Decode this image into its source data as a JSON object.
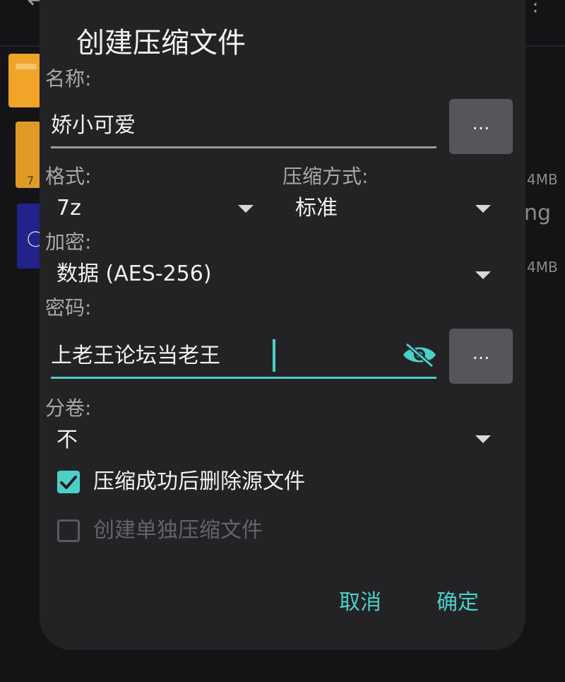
{
  "dialog": {
    "title": "创建压缩文件",
    "name_label": "名称:",
    "name_value": "娇小可爱",
    "name_browse_label": "...",
    "format_label": "格式:",
    "format_value": "7z",
    "compression_label": "压缩方式:",
    "compression_value": "标准",
    "encryption_label": "加密:",
    "encryption_value": "数据 (AES-256)",
    "password_label": "密码:",
    "password_value": "上老王论坛当老王",
    "password_browse_label": "...",
    "split_label": "分卷:",
    "split_value": "不",
    "delete_source": {
      "label": "压缩成功后删除源文件",
      "checked": true
    },
    "separate_archives": {
      "label": "创建单独压缩文件",
      "checked": false,
      "enabled": false
    },
    "cancel_label": "取消",
    "confirm_label": "确定"
  },
  "background": {
    "size_1": "4MB",
    "text_fragment": "ng",
    "size_2": "4MB",
    "zip_badge": "7"
  },
  "colors": {
    "accent": "#4ccfc7",
    "dialog_bg": "#232326",
    "button_bg": "#55555a"
  },
  "icons": {
    "back": "arrow-left-icon",
    "more": "more-vertical-icon",
    "eye": "eye-off-icon",
    "dropdown": "chevron-down-icon",
    "check": "check-icon"
  }
}
